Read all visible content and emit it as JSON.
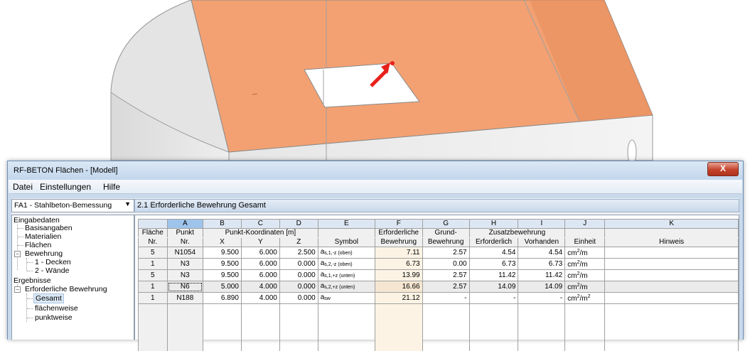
{
  "window": {
    "title": "RF-BETON Flächen - [Modell]",
    "close_label": "X"
  },
  "menu": [
    "Datei",
    "Einstellungen",
    "Hilfe"
  ],
  "module_select": "FA1 - Stahlbeton-Bemessung",
  "nav": [
    "Eingabedaten",
    "Basisangaben",
    "Materialien",
    "Flächen",
    "Bewehrung",
    "1 - Decken",
    "2 - Wände",
    "Ergebnisse",
    "Erforderliche Bewehrung",
    "Gesamt",
    "flächenweise",
    "punktweise"
  ],
  "panel_title": "2.1 Erforderliche Bewehrung Gesamt",
  "table": {
    "letters": [
      "A",
      "B",
      "C",
      "D",
      "E",
      "F",
      "G",
      "H",
      "I",
      "J",
      "K"
    ],
    "hdr1": {
      "flaeche": "Fläche",
      "punkt": "Punkt",
      "koord": "Punkt-Koordinaten [m]",
      "erf": "Erforderliche",
      "grund": "Grund-",
      "zusatz": "Zusatzbewehrung"
    },
    "hdr2": {
      "nr": "Nr.",
      "pnr": "Nr.",
      "x": "X",
      "y": "Y",
      "z": "Z",
      "symbol": "Symbol",
      "bew1": "Bewehrung",
      "bew2": "Bewehrung",
      "erf": "Erforderlich",
      "vorh": "Vorhanden",
      "einheit": "Einheit",
      "hinweis": "Hinweis"
    },
    "rows": [
      {
        "flaeche": "5",
        "punkt": "N1054",
        "x": "9.500",
        "y": "6.000",
        "z": "2.500",
        "sym_base": "a",
        "sym_sub": "s,1,-z (oben)",
        "erf": "7.11",
        "grund": "2.57",
        "zerf": "4.54",
        "zvorh": "4.54",
        "unit": "cm",
        "unit_exp": "2",
        "unit_tail": "/m"
      },
      {
        "flaeche": "1",
        "punkt": "N3",
        "x": "9.500",
        "y": "6.000",
        "z": "0.000",
        "sym_base": "a",
        "sym_sub": "s,2,-z (oben)",
        "erf": "6.73",
        "grund": "0.00",
        "zerf": "6.73",
        "zvorh": "6.73",
        "unit": "cm",
        "unit_exp": "2",
        "unit_tail": "/m"
      },
      {
        "flaeche": "5",
        "punkt": "N3",
        "x": "9.500",
        "y": "6.000",
        "z": "0.000",
        "sym_base": "a",
        "sym_sub": "s,1,+z (unten)",
        "erf": "13.99",
        "grund": "2.57",
        "zerf": "11.42",
        "zvorh": "11.42",
        "unit": "cm",
        "unit_exp": "2",
        "unit_tail": "/m"
      },
      {
        "flaeche": "1",
        "punkt": "N6",
        "x": "5.000",
        "y": "4.000",
        "z": "0.000",
        "sym_base": "a",
        "sym_sub": "s,2,+z (unten)",
        "erf": "16.66",
        "grund": "2.57",
        "zerf": "14.09",
        "zvorh": "14.09",
        "unit": "cm",
        "unit_exp": "2",
        "unit_tail": "/m"
      },
      {
        "flaeche": "1",
        "punkt": "N188",
        "x": "6.890",
        "y": "4.000",
        "z": "0.000",
        "sym_base": "a",
        "sym_sub": "sw",
        "erf": "21.12",
        "grund": "-",
        "zerf": "-",
        "zvorh": "-",
        "unit": "cm",
        "unit_exp": "2",
        "unit_tail": "/m",
        "unit_exp2": "2"
      }
    ]
  },
  "colors": {
    "slab": "#f3a172",
    "marker": "#e8201a"
  }
}
